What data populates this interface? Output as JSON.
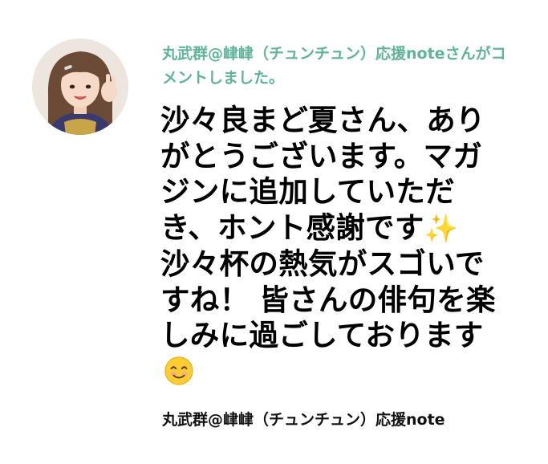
{
  "notification": {
    "author": "丸武群@峍峍（チュンチュン）応援note",
    "action": "さんがコメントしました。"
  },
  "comment": {
    "text_before_sparkles": "沙々良まど夏さん、ありがとうございます。マガジンに追加していただき、ホント感謝です",
    "sparkles_emoji": "✨",
    "text_after_sparkles": " 沙々杯の熱気がスゴいですね！ 皆さんの俳句を楽しみに過ごしております",
    "smile_emoji": "😊"
  },
  "footer": {
    "author_name": "丸武群@峍峍（チュンチュン）応援note"
  },
  "colors": {
    "accent": "#5fb39b",
    "text": "#000000"
  },
  "icons": {
    "avatar": "user-avatar-photo",
    "sparkles": "sparkles-icon",
    "smile": "smiling-face-icon"
  }
}
